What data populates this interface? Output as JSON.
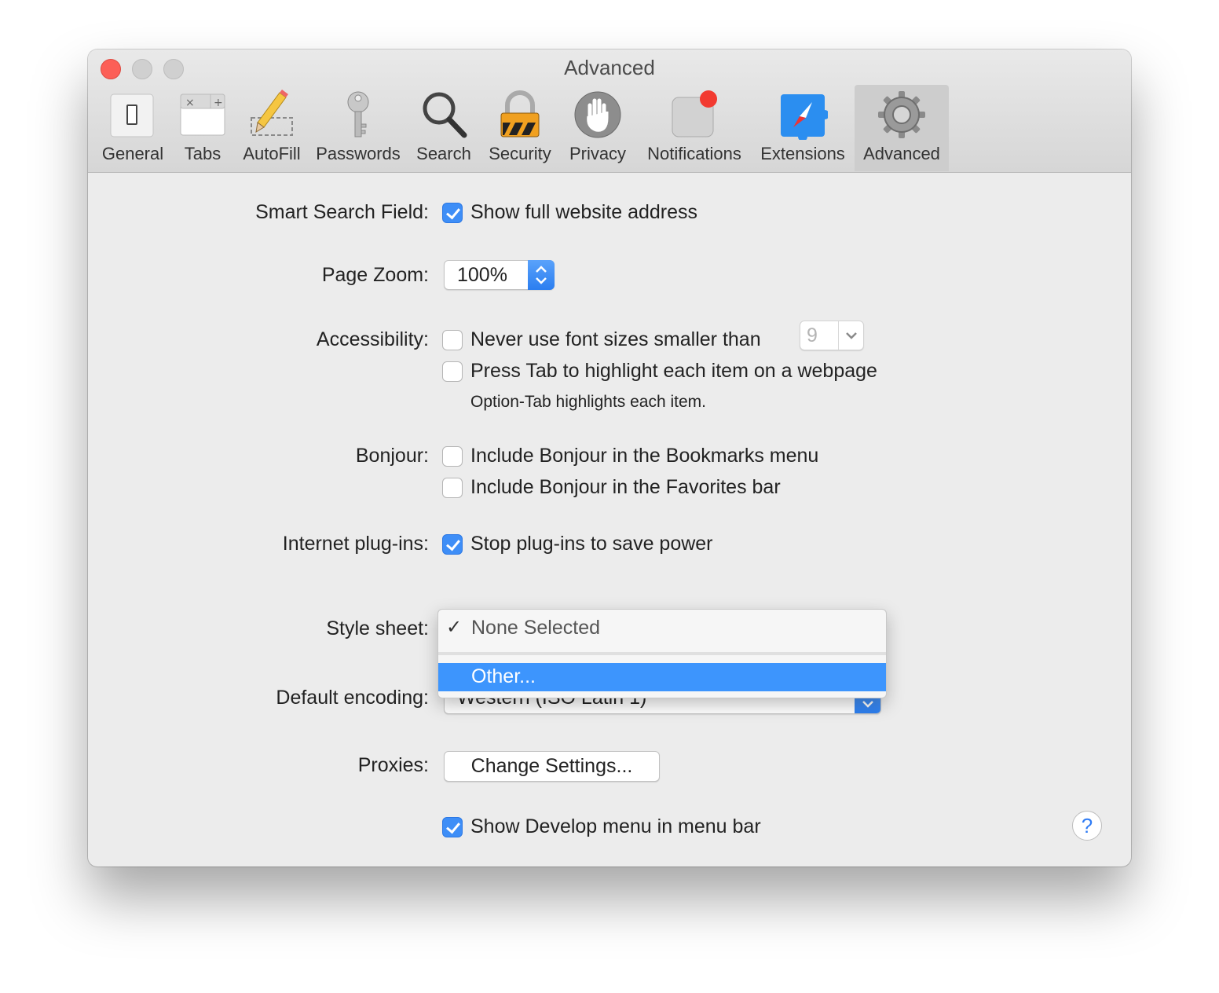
{
  "window": {
    "title": "Advanced"
  },
  "toolbar": [
    {
      "id": "general",
      "label": "General",
      "icon": "general-switch-icon"
    },
    {
      "id": "tabs",
      "label": "Tabs",
      "icon": "tabs-icon"
    },
    {
      "id": "autofill",
      "label": "AutoFill",
      "icon": "pencil-icon"
    },
    {
      "id": "passwords",
      "label": "Passwords",
      "icon": "key-icon"
    },
    {
      "id": "search",
      "label": "Search",
      "icon": "magnifier-icon"
    },
    {
      "id": "security",
      "label": "Security",
      "icon": "padlock-icon"
    },
    {
      "id": "privacy",
      "label": "Privacy",
      "icon": "hand-icon"
    },
    {
      "id": "notifications",
      "label": "Notifications",
      "icon": "notification-badge-icon"
    },
    {
      "id": "extensions",
      "label": "Extensions",
      "icon": "puzzle-compass-icon"
    },
    {
      "id": "advanced",
      "label": "Advanced",
      "icon": "gear-icon",
      "selected": true
    }
  ],
  "settings": {
    "smart_search": {
      "label": "Smart Search Field:",
      "option": "Show full website address",
      "checked": true
    },
    "page_zoom": {
      "label": "Page Zoom:",
      "value": "100%"
    },
    "accessibility": {
      "label": "Accessibility:",
      "font_size_option": "Never use font sizes smaller than",
      "font_size_checked": false,
      "font_size_value": "9",
      "tab_option": "Press Tab to highlight each item on a webpage",
      "tab_checked": false,
      "note": "Option-Tab highlights each item."
    },
    "bonjour": {
      "label": "Bonjour:",
      "bookmarks_option": "Include Bonjour in the Bookmarks menu",
      "bookmarks_checked": false,
      "favorites_option": "Include Bonjour in the Favorites bar",
      "favorites_checked": false
    },
    "plugins": {
      "label": "Internet plug-ins:",
      "option": "Stop plug-ins to save power",
      "checked": true
    },
    "style_sheet": {
      "label": "Style sheet:",
      "menu": [
        {
          "label": "None Selected",
          "checked": true,
          "highlighted": false
        },
        {
          "label": "Other...",
          "checked": false,
          "highlighted": true
        }
      ]
    },
    "encoding": {
      "label": "Default encoding:",
      "value": "Western (ISO Latin 1)"
    },
    "proxies": {
      "label": "Proxies:",
      "button": "Change Settings..."
    },
    "develop": {
      "option": "Show Develop menu in menu bar",
      "checked": true
    }
  },
  "help": {
    "glyph": "?"
  },
  "colors": {
    "accent": "#3e8ef7",
    "menu_highlight": "#3d95fd",
    "close": "#fc5f57"
  }
}
